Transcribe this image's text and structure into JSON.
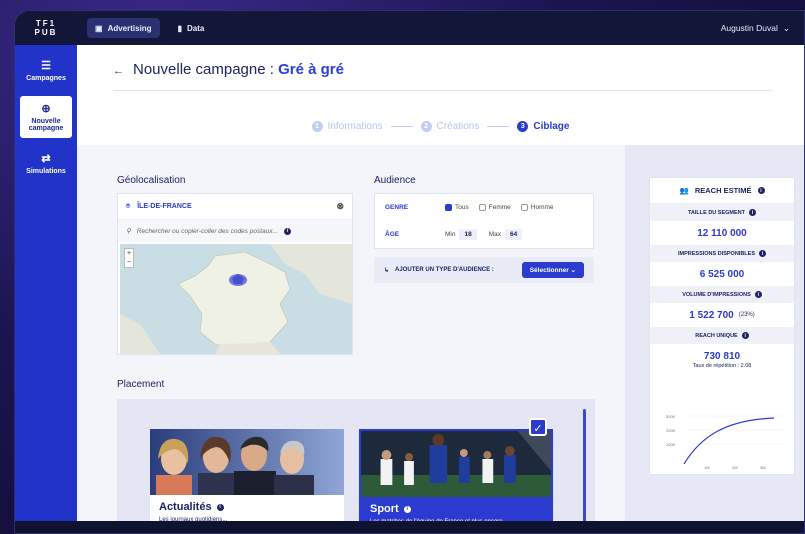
{
  "topbar": {
    "logo_line1": "TF1",
    "logo_line2": "PUB",
    "tabs": [
      {
        "label": "Advertising",
        "icon": "monitor-icon",
        "active": true
      },
      {
        "label": "Data",
        "icon": "bar-chart-icon",
        "active": false
      }
    ],
    "user": "Augustin Duval"
  },
  "sidebar": {
    "items": [
      {
        "label": "Campagnes",
        "icon": "campaigns-icon",
        "active": false
      },
      {
        "label": "Nouvelle campagne",
        "icon": "plus-circle-icon",
        "active": true
      },
      {
        "label": "Simulations",
        "icon": "simulations-icon",
        "active": false
      }
    ]
  },
  "header": {
    "title": "Nouvelle campagne :",
    "subtitle": "Gré à gré"
  },
  "steps": [
    {
      "num": "1",
      "label": "Informations"
    },
    {
      "num": "2",
      "label": "Créations"
    },
    {
      "num": "3",
      "label": "Ciblage",
      "active": true
    }
  ],
  "geo": {
    "title": "Géolocalisation",
    "region": "ÎLE-DE-FRANCE",
    "search_placeholder": "Rechercher ou copier-coller des codes postaux..."
  },
  "audience": {
    "title": "Audience",
    "genre_label": "GENRE",
    "genre_options": [
      {
        "label": "Tous",
        "checked": true
      },
      {
        "label": "Femme",
        "checked": false
      },
      {
        "label": "Homme",
        "checked": false
      }
    ],
    "age_label": "ÂGE",
    "min_label": "Min",
    "min_value": "18",
    "max_label": "Max",
    "max_value": "64",
    "add_label": "AJOUTER UN TYPE D'AUDIENCE :",
    "select_label": "Sélectionner"
  },
  "placement": {
    "title": "Placement",
    "cards": [
      {
        "title": "Actualités",
        "desc": "Les journaux quotidiens..."
      },
      {
        "title": "Sport",
        "desc": "Les matches de l'équipe de France et plus encore...",
        "selected": true
      }
    ]
  },
  "reach": {
    "title": "REACH ESTIMÉ",
    "metrics": [
      {
        "label": "TAILLE DU SEGMENT",
        "value": "12 110 000"
      },
      {
        "label": "IMPRESSIONS DISPONIBLES",
        "value": "6 525 000"
      },
      {
        "label": "VOLUME D'IMPRESSIONS",
        "value": "1 522 700",
        "pct": "(23%)"
      },
      {
        "label": "REACH UNIQUE",
        "value": "730 810"
      }
    ],
    "repetition": "Taux de répétition : 2.08",
    "chart_y_ticks": [
      "300K",
      "200K",
      "100K"
    ],
    "chart_x_ticks": [
      "1M",
      "2M",
      "3M"
    ]
  },
  "colors": {
    "accent": "#2b3bd0",
    "sidebar": "#2133c9",
    "navy": "#1c2462"
  }
}
